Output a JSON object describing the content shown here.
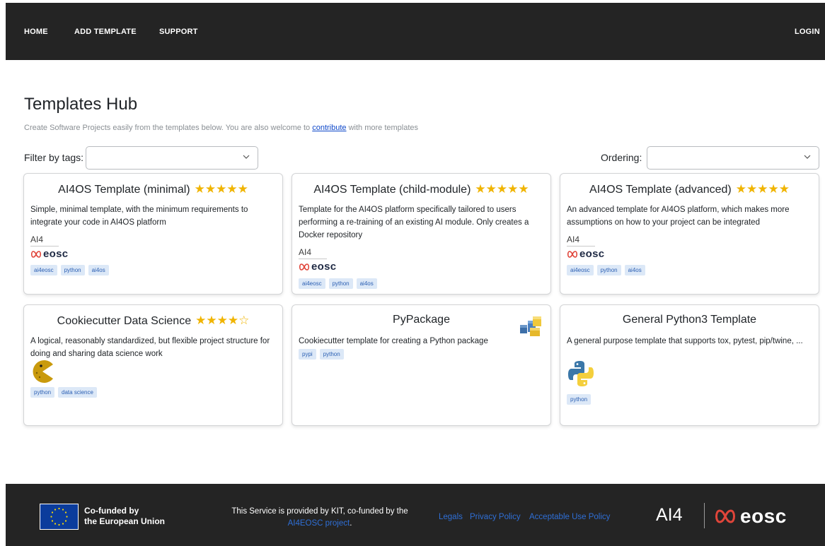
{
  "nav": {
    "home": "HOME",
    "add_template": "ADD TEMPLATE",
    "support": "SUPPORT",
    "login": "LOGIN"
  },
  "header": {
    "title": "Templates Hub",
    "subtitle_before": "Create Software Projects easily from the templates below. You are also welcome to ",
    "subtitle_link": "contribute",
    "subtitle_after": " with more templates"
  },
  "filters": {
    "tags_label": "Filter by tags:",
    "tags_value": "",
    "ordering_label": "Ordering:",
    "ordering_value": ""
  },
  "cards": [
    {
      "title": "AI4OS Template (minimal)",
      "rating": 5,
      "stars": "★★★★★",
      "description": "Simple, minimal template, with the minimum requirements to integrate your code in AI4OS platform",
      "logo": "ai4-eosc-logo",
      "logo_text_ai4": "AI4",
      "logo_text_eosc": "eosc",
      "tags": [
        "ai4eosc",
        "python",
        "ai4os"
      ]
    },
    {
      "title": "AI4OS Template (child-module)",
      "rating": 5,
      "stars": "★★★★★",
      "description": "Template for the AI4OS platform specifically tailored to users performing a re-training of an existing AI module. Only creates a Docker repository",
      "logo": "ai4-eosc-logo",
      "logo_text_ai4": "AI4",
      "logo_text_eosc": "eosc",
      "tags": [
        "ai4eosc",
        "python",
        "ai4os"
      ]
    },
    {
      "title": "AI4OS Template (advanced)",
      "rating": 5,
      "stars": "★★★★★",
      "description": "An advanced template for AI4OS platform, which makes more assumptions on how to your project can be integrated",
      "logo": "ai4-eosc-logo",
      "logo_text_ai4": "AI4",
      "logo_text_eosc": "eosc",
      "tags": [
        "ai4eosc",
        "python",
        "ai4os"
      ]
    },
    {
      "title": "Cookiecutter Data Science",
      "rating": 4,
      "stars": "★★★★☆",
      "description": "A logical, reasonably standardized, but flexible project structure for doing and sharing data science work",
      "logo": "cookie-pacman-icon",
      "tags": [
        "python",
        "data science"
      ]
    },
    {
      "title": "PyPackage",
      "description": "Cookiecutter template for creating a Python package",
      "logo": "python-package-icon",
      "tags": [
        "pypi",
        "python"
      ]
    },
    {
      "title": "General Python3 Template",
      "description": "A general purpose template that supports tox, pytest, pip/twine, ...",
      "logo": "python-logo-icon",
      "tags": [
        "python"
      ]
    }
  ],
  "footer": {
    "eu_line1": "Co-funded by",
    "eu_line2": "the European Union",
    "service_text": "This Service is provided by KIT, co-funded by the",
    "service_link": "AI4EOSC project",
    "service_period": ".",
    "legals": "Legals",
    "privacy": "Privacy Policy",
    "aup": "Acceptable Use Policy",
    "logo_ai4": "AI4",
    "logo_eosc": "eosc"
  },
  "colors": {
    "navbar_bg": "#242424",
    "star": "#f0b400",
    "tag_bg": "#dce8f7",
    "tag_text": "#2b5fb3",
    "link": "#2f6fd6"
  }
}
